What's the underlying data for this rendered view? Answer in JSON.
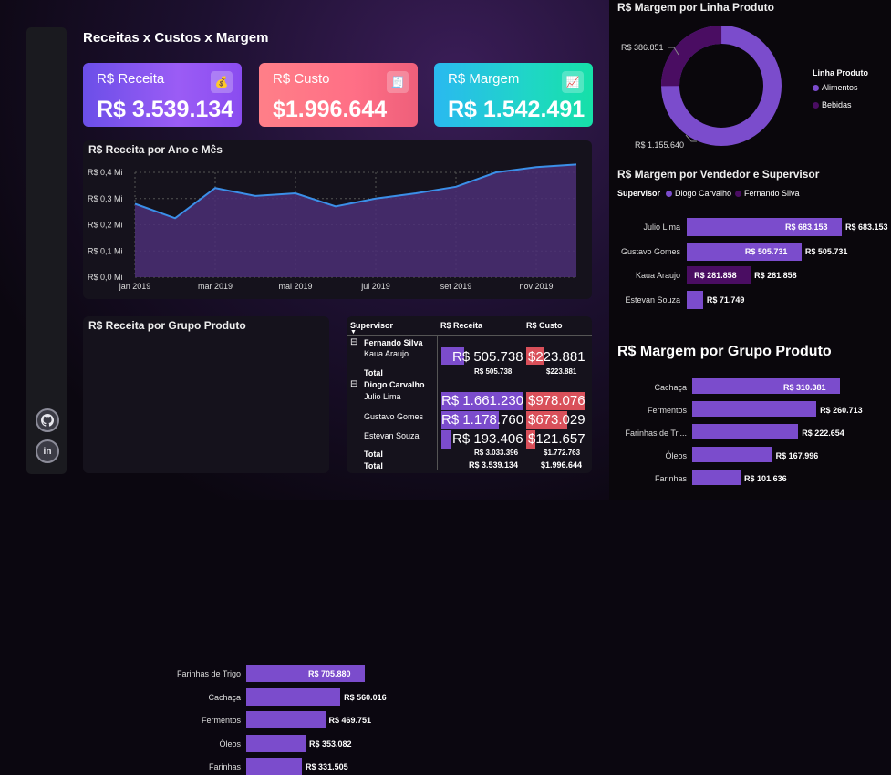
{
  "page_title": "Receitas x Custos x Margem",
  "kpis": [
    {
      "label": "R$ Receita",
      "value": "R$ 3.539.134",
      "icon": "money-bag-icon"
    },
    {
      "label": "R$ Custo",
      "value": "$1.996.644",
      "icon": "invoice-icon"
    },
    {
      "label": "R$ Margem",
      "value": "R$ 1.542.491",
      "icon": "growth-icon"
    }
  ],
  "social": {
    "github": "github-icon",
    "linkedin": "in"
  },
  "colors": {
    "purple": "#7b4ccc",
    "dark_purple": "#4a0d62",
    "red": "#d9505a",
    "line": "#3b8fe8"
  },
  "line_chart": {
    "title": "R$ Receita por Ano e Mês",
    "y_ticks": [
      "R$ 0,4 Mi",
      "R$ 0,3 Mi",
      "R$ 0,2 Mi",
      "R$ 0,1 Mi",
      "R$ 0,0 Mi"
    ],
    "x_ticks": [
      "jan 2019",
      "mar 2019",
      "mai 2019",
      "jul 2019",
      "set 2019",
      "nov 2019"
    ]
  },
  "bar_grupo": {
    "title": "R$ Receita por Grupo Produto",
    "items": [
      {
        "label": "Farinhas de Trigo",
        "text": "R$ 705.880"
      },
      {
        "label": "Cachaça",
        "text": "R$ 560.016"
      },
      {
        "label": "Fermentos",
        "text": "R$ 469.751"
      },
      {
        "label": "Óleos",
        "text": "R$ 353.082"
      },
      {
        "label": "Farinhas",
        "text": "R$ 331.505"
      }
    ]
  },
  "matrix": {
    "headers": {
      "supervisor": "Supervisor",
      "receita": "R$ Receita",
      "custo": "R$ Custo"
    },
    "groups": [
      {
        "name": "Fernando Silva",
        "rows": [
          {
            "name": "Kaua Araujo",
            "receita": "R$ 505.738",
            "custo": "$223.881"
          }
        ],
        "total_label": "Total",
        "total_receita": "R$ 505.738",
        "total_custo": "$223.881"
      },
      {
        "name": "Diogo Carvalho",
        "rows": [
          {
            "name": "Julio Lima",
            "receita": "R$ 1.661.230",
            "custo": "$978.076"
          },
          {
            "name": "Gustavo Gomes",
            "receita": "R$ 1.178.760",
            "custo": "$673.029"
          },
          {
            "name": "Estevan Souza",
            "receita": "R$ 193.406",
            "custo": "$121.657"
          }
        ],
        "total_label": "Total",
        "total_receita": "R$ 3.033.396",
        "total_custo": "$1.772.763"
      }
    ],
    "grand_total_label": "Total",
    "grand_total_receita": "R$ 3.539.134",
    "grand_total_custo": "$1.996.644"
  },
  "donut": {
    "title": "R$ Margem por Linha Produto",
    "legend_title": "Linha Produto",
    "label_small": "R$ 386.851",
    "label_large": "R$ 1.155.640",
    "legend": [
      "Alimentos",
      "Bebidas"
    ]
  },
  "vendedor": {
    "title": "R$ Margem por Vendedor e Supervisor",
    "legend_title": "Supervisor",
    "legend": [
      "Diogo Carvalho",
      "Fernando Silva"
    ],
    "items": [
      {
        "label": "Julio Lima",
        "inner": "R$ 683.153",
        "outer": "R$ 683.153"
      },
      {
        "label": "Gustavo Gomes",
        "inner": "R$ 505.731",
        "outer": "R$ 505.731"
      },
      {
        "label": "Kaua Araujo",
        "inner": "R$ 281.858",
        "outer": "R$ 281.858"
      },
      {
        "label": "Estevan Souza",
        "inner": "",
        "outer": "R$ 71.749"
      }
    ]
  },
  "margem_grupo": {
    "title": "R$ Margem por Grupo Produto",
    "items": [
      {
        "label": "Cachaça",
        "text": "R$ 310.381"
      },
      {
        "label": "Fermentos",
        "text": "R$ 260.713"
      },
      {
        "label": "Farinhas de Tri...",
        "text": "R$ 222.654"
      },
      {
        "label": "Óleos",
        "text": "R$ 167.996"
      },
      {
        "label": "Farinhas",
        "text": "R$ 101.636"
      }
    ]
  },
  "chart_data": [
    {
      "type": "area",
      "title": "R$ Receita por Ano e Mês",
      "x": [
        "jan 2019",
        "fev 2019",
        "mar 2019",
        "abr 2019",
        "mai 2019",
        "jun 2019",
        "jul 2019",
        "ago 2019",
        "set 2019",
        "out 2019",
        "nov 2019",
        "dez 2019"
      ],
      "values": [
        0.28,
        0.225,
        0.34,
        0.31,
        0.32,
        0.27,
        0.3,
        0.32,
        0.345,
        0.4,
        0.42,
        0.43
      ],
      "ylabel": "R$ Mi",
      "ylim": [
        0,
        0.45
      ]
    },
    {
      "type": "bar",
      "title": "R$ Receita por Grupo Produto",
      "categories": [
        "Farinhas de Trigo",
        "Cachaça",
        "Fermentos",
        "Óleos",
        "Farinhas"
      ],
      "values": [
        705880,
        560016,
        469751,
        353082,
        331505
      ]
    },
    {
      "type": "pie",
      "title": "R$ Margem por Linha Produto",
      "categories": [
        "Alimentos",
        "Bebidas"
      ],
      "values": [
        1155640,
        386851
      ]
    },
    {
      "type": "bar",
      "title": "R$ Margem por Vendedor e Supervisor",
      "categories": [
        "Julio Lima",
        "Gustavo Gomes",
        "Kaua Araujo",
        "Estevan Souza"
      ],
      "series": [
        {
          "name": "Diogo Carvalho",
          "values": [
            683153,
            505731,
            0,
            71749
          ]
        },
        {
          "name": "Fernando Silva",
          "values": [
            0,
            0,
            281858,
            0
          ]
        }
      ]
    },
    {
      "type": "bar",
      "title": "R$ Margem por Grupo Produto",
      "categories": [
        "Cachaça",
        "Fermentos",
        "Farinhas de Trigo",
        "Óleos",
        "Farinhas"
      ],
      "values": [
        310381,
        260713,
        222654,
        167996,
        101636
      ]
    },
    {
      "type": "table",
      "title": "Receita e Custo por Supervisor e Vendedor",
      "rows": [
        {
          "supervisor": "Fernando Silva",
          "vendedor": "Kaua Araujo",
          "receita": 505738,
          "custo": 223881
        },
        {
          "supervisor": "Diogo Carvalho",
          "vendedor": "Julio Lima",
          "receita": 1661230,
          "custo": 978076
        },
        {
          "supervisor": "Diogo Carvalho",
          "vendedor": "Gustavo Gomes",
          "receita": 1178760,
          "custo": 673029
        },
        {
          "supervisor": "Diogo Carvalho",
          "vendedor": "Estevan Souza",
          "receita": 193406,
          "custo": 121657
        }
      ]
    }
  ]
}
